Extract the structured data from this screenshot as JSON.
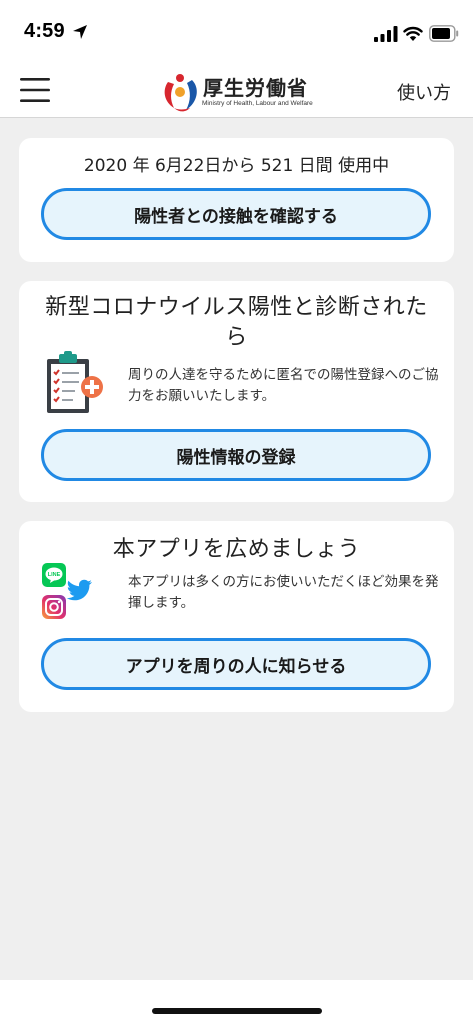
{
  "status_bar": {
    "time": "4:59"
  },
  "header": {
    "logo_title": "厚生労働省",
    "logo_subtitle": "Ministry of Health, Labour and Welfare",
    "help_link": "使い方"
  },
  "usage_card": {
    "usage_text": "2020 年 6月22日から 521 日間 使用中",
    "check_button": "陽性者との接触を確認する"
  },
  "register_card": {
    "title": "新型コロナウイルス陽性と診断されたら",
    "description": "周りの人達を守るために匿名での陽性登録へのご協力をお願いいたします。",
    "register_button": "陽性情報の登録"
  },
  "share_card": {
    "title": "本アプリを広めましょう",
    "description": "本アプリは多くの方にお使いいただくほど効果を発揮します。",
    "share_button": "アプリを周りの人に知らせる",
    "line_label": "LINE"
  },
  "colors": {
    "accent": "#2189e4",
    "button_fill": "#e6f4fc",
    "background": "#efefef"
  }
}
